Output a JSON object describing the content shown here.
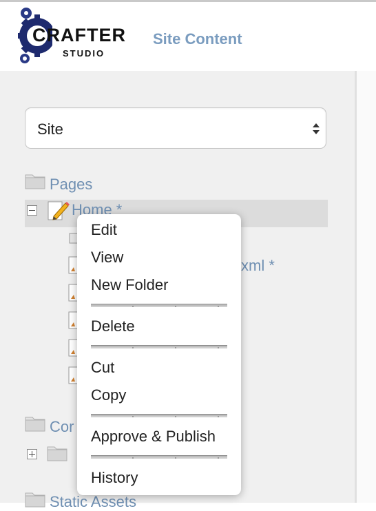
{
  "header": {
    "logo": {
      "name": "CRAFTER",
      "sub": "STUDIO"
    },
    "title": "Site Content"
  },
  "site_select": {
    "value": "Site"
  },
  "tree": {
    "pages_label": "Pages",
    "home_label": "Home *",
    "xml_partial": "xml *",
    "components_label": "Cor",
    "static_label": "Static Assets"
  },
  "context_menu": {
    "items": [
      "Edit",
      "View",
      "New Folder",
      "Delete",
      "Cut",
      "Copy",
      "Approve & Publish",
      "History"
    ]
  },
  "colors": {
    "link": "#6f8fb2",
    "title": "#7a9cbf",
    "highlight": "#dcdcdc",
    "sidebar": "#f0f0f0"
  }
}
